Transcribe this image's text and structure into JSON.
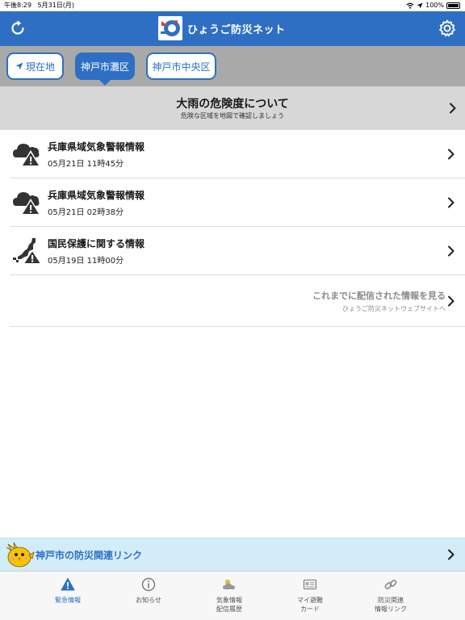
{
  "status_bar": {
    "time": "午後8:29",
    "date": "5月31日(月)",
    "battery": "100%"
  },
  "header": {
    "title": "ひょうご防災ネット"
  },
  "area_tabs": [
    {
      "label": "現在地",
      "selected": false
    },
    {
      "label": "神戸市灘区",
      "selected": true
    },
    {
      "label": "神戸市中央区",
      "selected": false
    }
  ],
  "banner": {
    "title": "大雨の危険度について",
    "subtitle": "危険な区域を地図で確認しましょう"
  },
  "info_items": [
    {
      "title": "兵庫県域気象警報情報",
      "date": "05月21日 11時45分",
      "icon": "storm-warning-icon"
    },
    {
      "title": "兵庫県域気象警報情報",
      "date": "05月21日 02時38分",
      "icon": "storm-warning-icon"
    },
    {
      "title": "国民保護に関する情報",
      "date": "05月19日 11時00分",
      "icon": "civil-protection-icon"
    }
  ],
  "more_link": {
    "title": "これまでに配信された情報を見る",
    "subtitle": "ひょうご防災ネットウェブサイトへ"
  },
  "kobe_link": {
    "label": "神戸市の防災関連リンク"
  },
  "tab_bar": [
    {
      "label": "緊急情報",
      "icon": "warning-triangle-icon",
      "active": true
    },
    {
      "label": "お知らせ",
      "icon": "info-icon",
      "active": false
    },
    {
      "label": "気象情報\n配信履歴",
      "label_line1": "気象情報",
      "label_line2": "配信履歴",
      "icon": "weather-icon",
      "active": false
    },
    {
      "label_line1": "マイ避難",
      "label_line2": "カード",
      "icon": "card-icon",
      "active": false
    },
    {
      "label_line1": "防災関連",
      "label_line2": "情報リンク",
      "icon": "link-icon",
      "active": false
    }
  ],
  "colors": {
    "brand_blue": "#2e6fc4",
    "tab_strip_gray": "#a9a9a9",
    "banner_gray": "#d7d7d7",
    "link_bar_blue": "#d2ecf8"
  }
}
